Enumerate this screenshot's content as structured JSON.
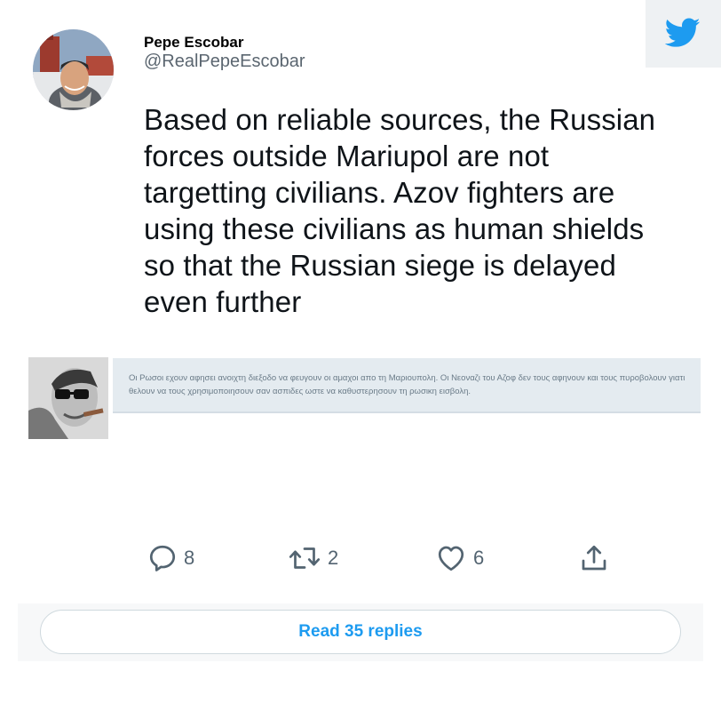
{
  "brand": {
    "icon": "twitter-bird-icon",
    "color": "#1d9bf0"
  },
  "author": {
    "display_name": "Pepe Escobar",
    "handle": "@RealPepeEscobar",
    "avatar": "avatar-photo"
  },
  "tweet": {
    "text": "Based on reliable sources, the Russian forces outside Mariupol are not targetting civilians. Azov fighters are using these civilians as human shields so that the Russian siege is delayed even further"
  },
  "quote": {
    "thumbnail": "man-with-glasses-portrait",
    "text": "Οι Ρωσοι εχουν αφησει ανοιχτη διεξοδο να φευγουν οι αμαχοι απο τη Μαριουπολη. Οι Νεοναζι του Αζοφ δεν τους αφηνουν και τους πυροβολουν γιατι θελουν να τους χρησιμοποιησουν σαν ασπιδες ωστε να καθυστερησουν τη ρωσικη εισβολη."
  },
  "actions": {
    "reply": {
      "icon": "reply-icon",
      "count": "8"
    },
    "retweet": {
      "icon": "retweet-icon",
      "count": "2"
    },
    "like": {
      "icon": "heart-icon",
      "count": "6"
    },
    "share": {
      "icon": "share-icon"
    }
  },
  "read_replies": {
    "label": "Read 35 replies"
  }
}
